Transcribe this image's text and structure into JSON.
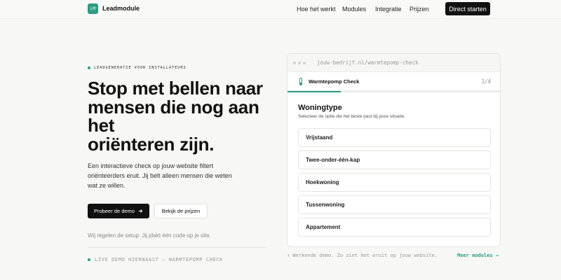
{
  "brand": {
    "logo_mark": "LM",
    "name": "Leadmodule",
    "accent_color": "#2d9c83"
  },
  "nav": {
    "links": [
      "Hoe het werkt",
      "Modules",
      "Integratie",
      "Prijzen"
    ],
    "cta": "Direct starten"
  },
  "hero": {
    "eyebrow": "LEADGENERATIE VOOR INSTALLATEURS",
    "headline_lines": [
      "Stop met bellen naar",
      "mensen die nog aan",
      "het",
      "oriënteren zijn."
    ],
    "lede_lines": [
      "Een interactieve check op jouw website filtert",
      "oriënteerders eruit. Jij belt alleen mensen die weten",
      "wat ze willen."
    ],
    "primary_button": "Probeer de demo",
    "primary_button_icon": "arrow-right-icon",
    "secondary_button": "Bekijk de prijzen",
    "setup_note": "Wij regelen de setup. Jij plakt één code op je site.",
    "live_demo": "LIVE DEMO HIERNAAST — WARMTEPOMP CHECK"
  },
  "demo": {
    "url": "jouw-bedrijf.nl/warmtepomp-check",
    "check_title": "Warmtepomp Check",
    "check_icon": "thermometer-icon",
    "step_label": "1/4",
    "progress": 0.25,
    "question_title": "Woningtype",
    "question_subtitle": "Selecteer de optie die het beste past bij jouw situatie.",
    "options": [
      "Vrijstaand",
      "Twee-onder-één-kap",
      "Hoekwoning",
      "Tussenwoning",
      "Appartement"
    ]
  },
  "footer": {
    "caption": "↑ Werkende demo. Zo ziet het eruit op jouw website.",
    "more_link": "Meer modules →"
  }
}
